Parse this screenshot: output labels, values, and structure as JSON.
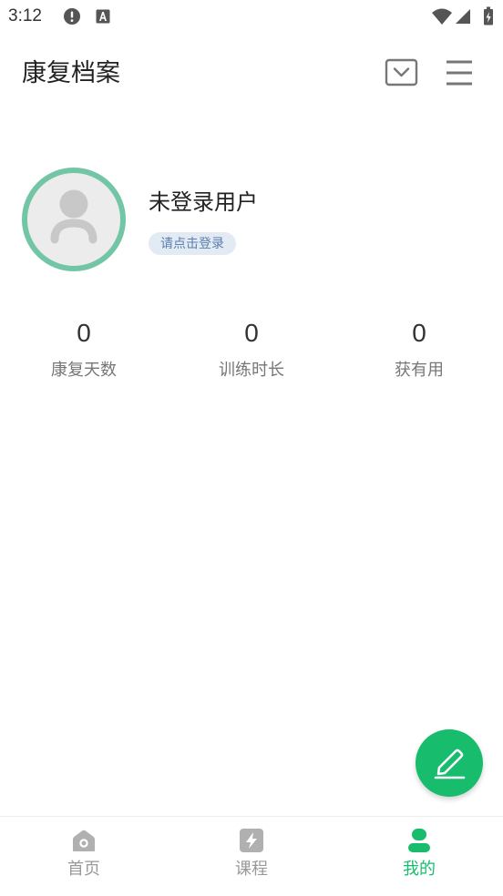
{
  "status_bar": {
    "time": "3:12",
    "icons": [
      "alert-icon",
      "text-a-icon",
      "wifi-icon",
      "cell-signal-icon",
      "battery-charging-icon"
    ]
  },
  "header": {
    "title": "康复档案",
    "icons": [
      "dropdown-box-icon",
      "menu-icon"
    ]
  },
  "profile": {
    "name": "未登录用户",
    "login_badge": "请点击登录",
    "avatar_icon": "default-avatar-icon"
  },
  "stats": [
    {
      "value": "0",
      "label": "康复天数"
    },
    {
      "value": "0",
      "label": "训练时长"
    },
    {
      "value": "0",
      "label": "获有用"
    }
  ],
  "fab": {
    "icon": "edit-icon"
  },
  "bottom_nav": {
    "items": [
      {
        "label": "首页",
        "icon": "home-icon",
        "active": false
      },
      {
        "label": "课程",
        "icon": "lightning-icon",
        "active": false
      },
      {
        "label": "我的",
        "icon": "user-icon",
        "active": true
      }
    ]
  },
  "colors": {
    "accent": "#17bd6d",
    "ring": "#72c6a5",
    "badge-bg": "#e2eaf4",
    "badge-text": "#5b7fae",
    "text-primary": "#222222",
    "text-secondary": "#777777",
    "nav-inactive": "#b0b0b0"
  }
}
